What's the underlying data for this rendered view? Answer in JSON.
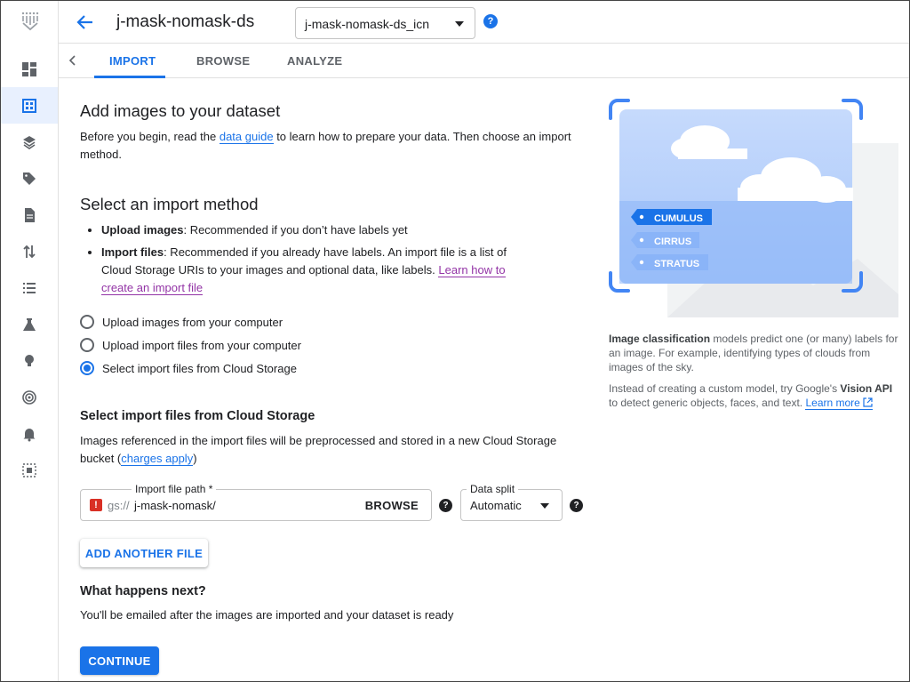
{
  "header": {
    "title": "j-mask-nomask-ds",
    "dataset_select": "j-mask-nomask-ds_icn",
    "help": "?"
  },
  "tabs": [
    {
      "label": "IMPORT",
      "active": true
    },
    {
      "label": "BROWSE",
      "active": false
    },
    {
      "label": "ANALYZE",
      "active": false
    }
  ],
  "rail": {
    "icons": [
      "vertex-logo-icon",
      "dashboard-icon",
      "datasets-icon",
      "models-icon",
      "labeling-icon",
      "notebooks-icon",
      "pipelines-icon",
      "training-icon",
      "experiments-icon",
      "suggestions-icon",
      "endpoints-icon",
      "notifications-icon",
      "more-icon"
    ],
    "active_index": 1
  },
  "main": {
    "heading": "Add images to your dataset",
    "intro_before": "Before you begin, read the ",
    "intro_link": "data guide",
    "intro_after": " to learn how to prepare your data. Then choose an import method.",
    "method_heading": "Select an import method",
    "bullet1_bold": "Upload images",
    "bullet1_text": ": Recommended if you don’t have labels yet",
    "bullet2_bold": "Import files",
    "bullet2_text": ": Recommended if you already have labels. An import file is a list of Cloud Storage URIs to your images and optional data, like labels. ",
    "bullet2_link": "Learn how to create an import file",
    "options": [
      {
        "label": "Upload images from your computer",
        "checked": false
      },
      {
        "label": "Upload import files from your computer",
        "checked": false
      },
      {
        "label": "Select import files from Cloud Storage",
        "checked": true
      }
    ],
    "gcs_heading": "Select import files from Cloud Storage",
    "gcs_desc_before": "Images referenced in the import files will be preprocessed and stored in a new Cloud Storage bucket (",
    "gcs_desc_link": "charges apply",
    "gcs_desc_after": ")",
    "path_label": "Import file path *",
    "path_prefix": "gs://",
    "path_value": "j-mask-nomask/",
    "browse": "BROWSE",
    "split_label": "Data split",
    "split_value": "Automatic",
    "add_file": "ADD ANOTHER FILE",
    "next_heading": "What happens next?",
    "next_text": "You'll be emailed after the images are imported and your dataset is ready",
    "continue": "CONTINUE"
  },
  "side": {
    "tags": [
      "CUMULUS",
      "CIRRUS",
      "STRATUS"
    ],
    "p1_bold": "Image classification",
    "p1_text": " models predict one (or many) labels for an image. For example, identifying types of clouds from images of the sky.",
    "p2_before": "Instead of creating a custom model, try Google's ",
    "p2_bold": "Vision API",
    "p2_after": " to detect generic objects, faces, and text. ",
    "p2_link": "Learn more"
  },
  "colors": {
    "accent": "#1a73e8",
    "error": "#d93025",
    "visited_link": "#9334a6"
  }
}
